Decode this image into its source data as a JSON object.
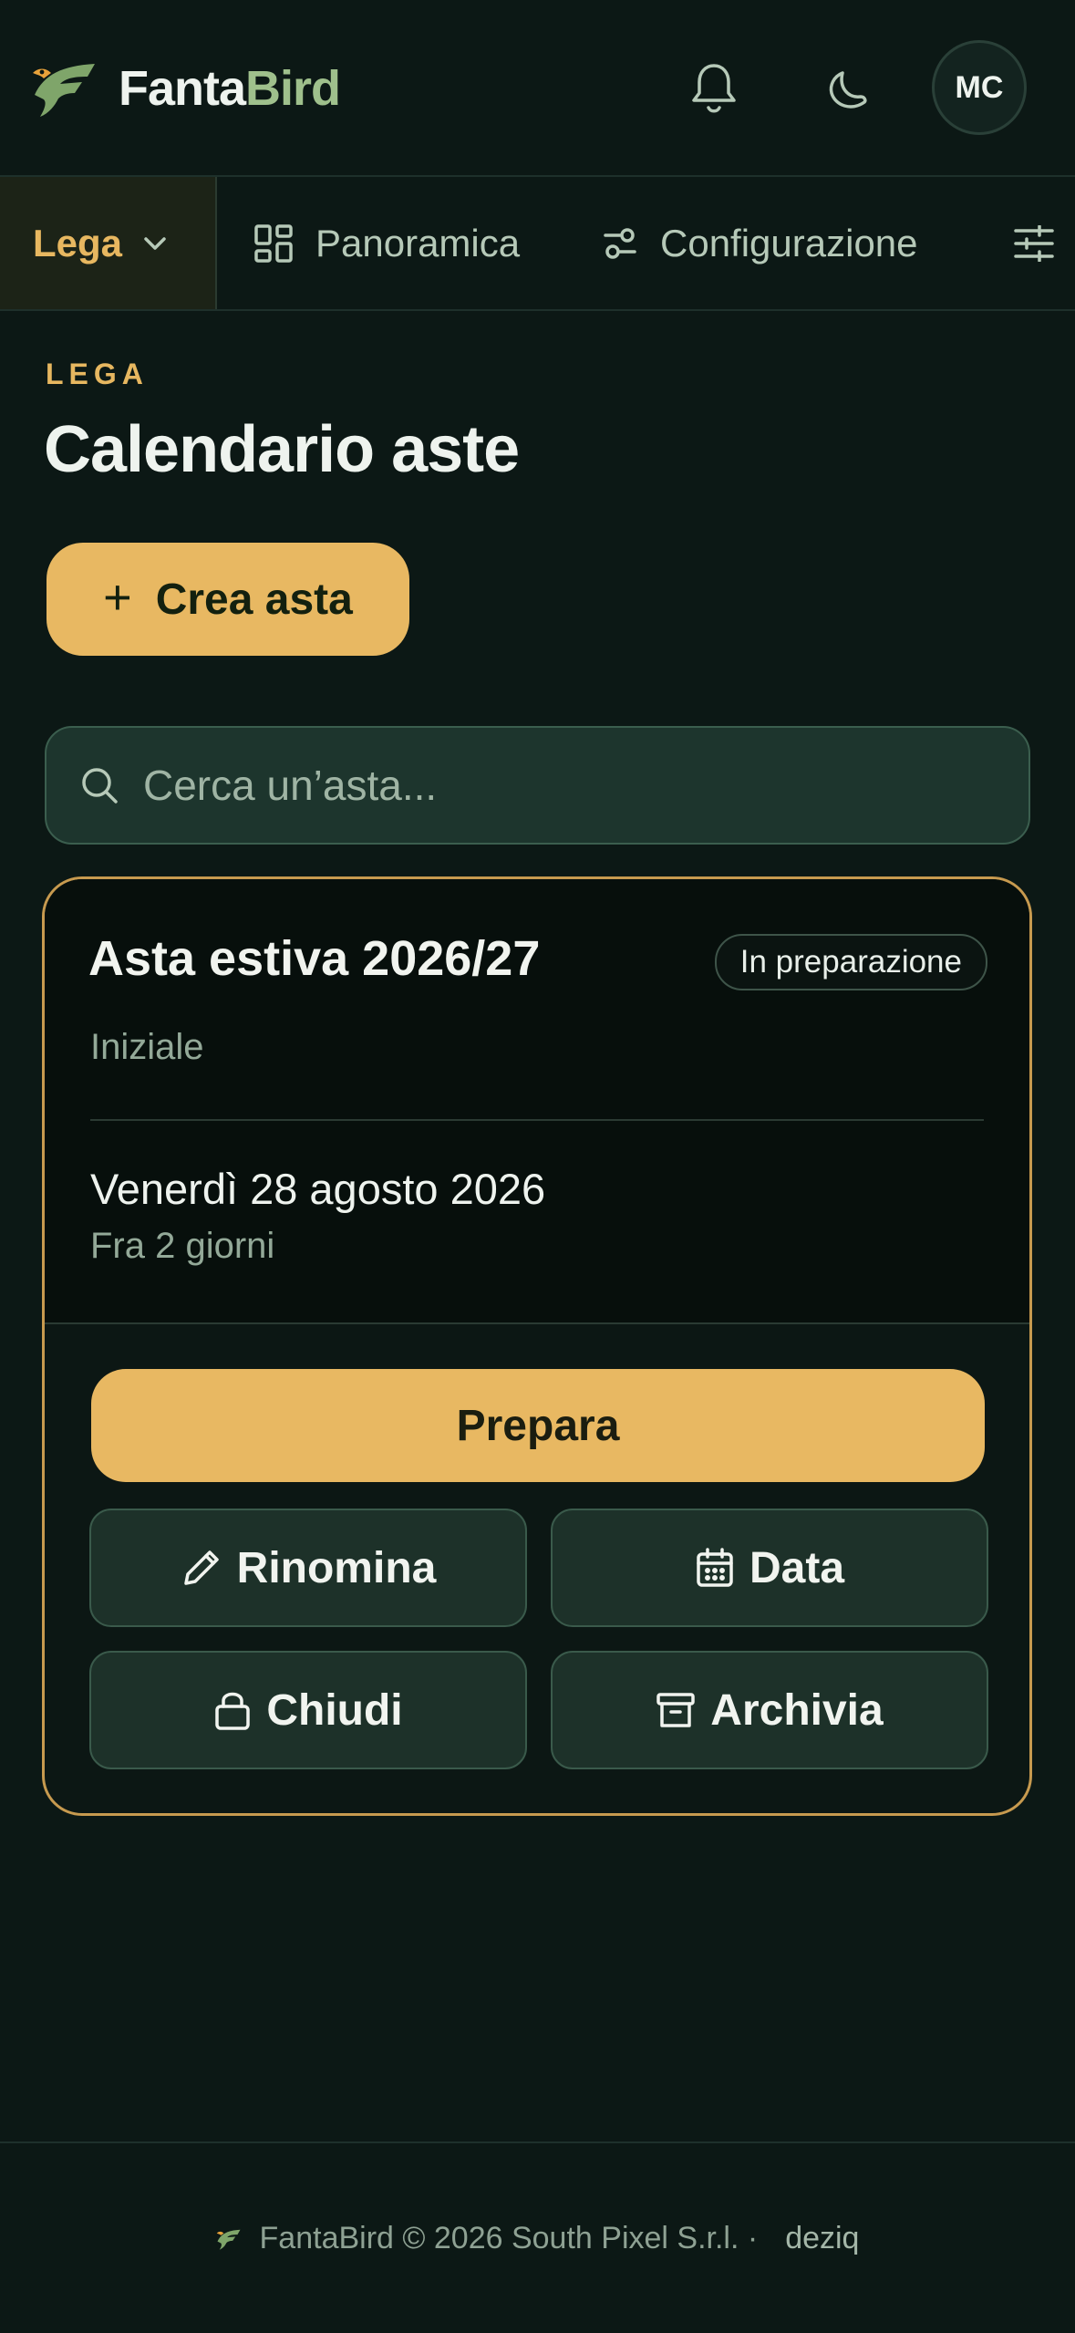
{
  "header": {
    "brand_part1": "Fanta",
    "brand_part2": "Bird",
    "avatar_initials": "MC",
    "icons": [
      "bell-icon",
      "moon-icon"
    ]
  },
  "tabs": {
    "active": "Lega",
    "items": [
      {
        "label": "Panoramica",
        "icon": "grid-icon"
      },
      {
        "label": "Configurazione",
        "icon": "toggles-icon"
      },
      {
        "label": "",
        "icon": "sliders-icon"
      }
    ]
  },
  "page": {
    "kicker": "LEGA",
    "title": "Calendario aste",
    "create_label": "Crea asta",
    "search_placeholder": "Cerca un’asta..."
  },
  "auction": {
    "title": "Asta estiva 2026/27",
    "status": "In preparazione",
    "type": "Iniziale",
    "date": "Venerdì 28 agosto 2026",
    "relative": "Fra 2 giorni",
    "actions": {
      "prepare": "Prepara",
      "rename": "Rinomina",
      "date": "Data",
      "close": "Chiudi",
      "archive": "Archivia"
    }
  },
  "footer": {
    "text": "FantaBird © 2026 South Pixel S.r.l. ·",
    "link": "deziq"
  },
  "colors": {
    "accent": "#e8b862",
    "background": "#0c1815",
    "brand_green": "#9fc08c"
  }
}
